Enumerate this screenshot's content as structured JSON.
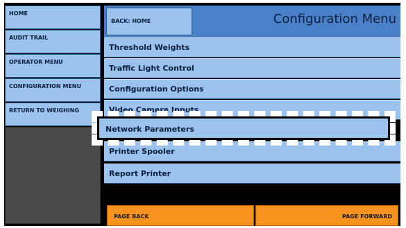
{
  "nav": {
    "items": [
      {
        "label": "HOME"
      },
      {
        "label": "AUDIT TRAIL"
      },
      {
        "label": "OPERATOR MENU"
      },
      {
        "label": "CONFIGURATION MENU"
      },
      {
        "label": "RETURN TO WEIGHING"
      }
    ]
  },
  "header": {
    "back_label": "BACK: HOME",
    "title": "Configuration Menu"
  },
  "menu": {
    "items": [
      {
        "label": "Threshold Weights"
      },
      {
        "label": "Traffic Light Control"
      },
      {
        "label": "Configuration Options"
      },
      {
        "label": "Video Camera Inputs"
      },
      {
        "label": "Network Parameters"
      },
      {
        "label": "Printer Spooler"
      },
      {
        "label": "Report Printer"
      }
    ]
  },
  "footer": {
    "page_back": "PAGE BACK",
    "page_forward": "PAGE FORWARD"
  }
}
